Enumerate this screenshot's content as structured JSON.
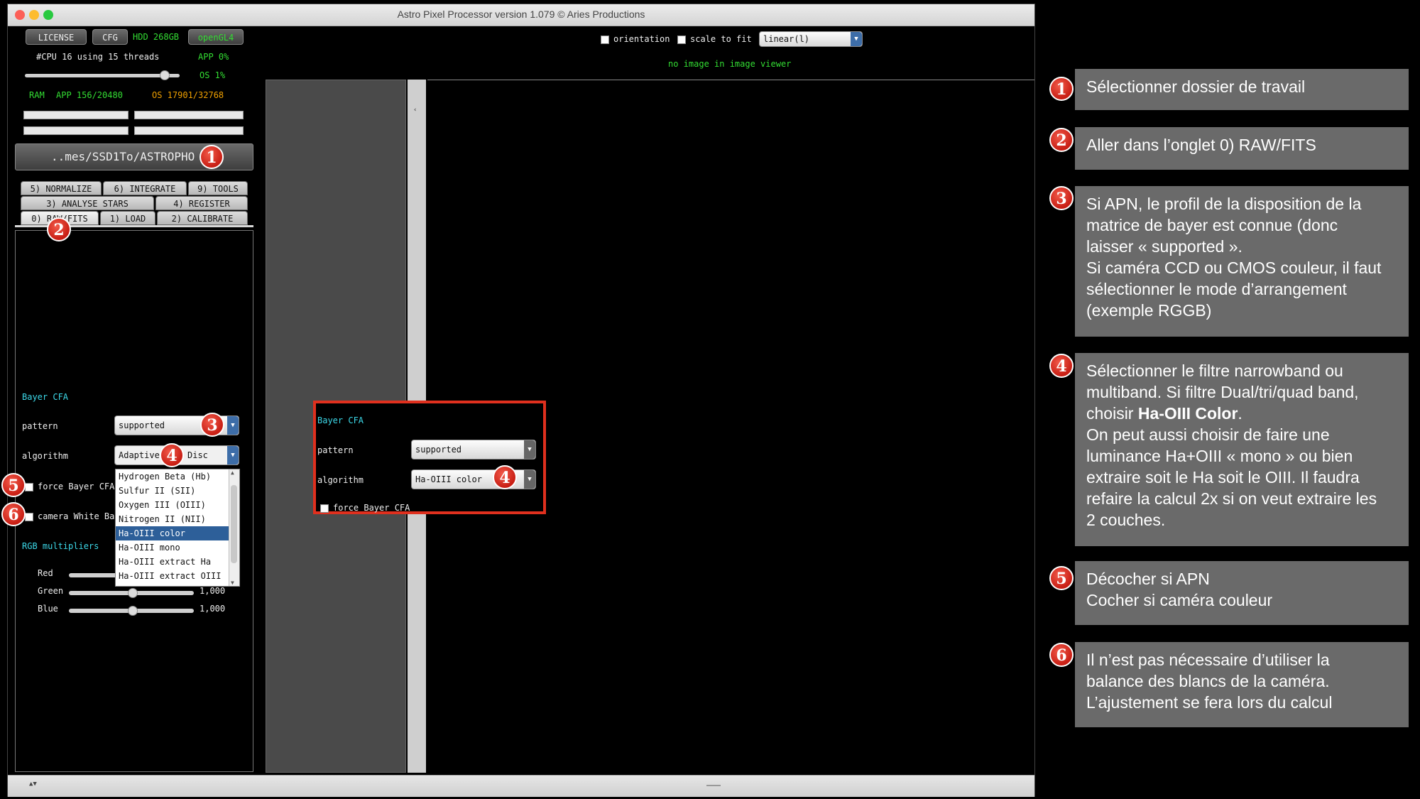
{
  "window": {
    "title": "Astro Pixel Processor version 1.079 © Aries Productions"
  },
  "top_buttons": {
    "license": "LICENSE",
    "cfg": "CFG",
    "hdd": "HDD 268GB",
    "opengl": "openGL4"
  },
  "system": {
    "cpu": "#CPU 16  using 15 threads",
    "app": "APP 0%",
    "os": "OS 1%",
    "ram_label": "RAM",
    "ram_app": "APP 156/20480",
    "ram_os": "OS 17901/32768"
  },
  "folder_button": "..mes/SSD1To/ASTROPHO",
  "tabs": {
    "row1": [
      "5) NORMALIZE",
      "6) INTEGRATE",
      "9) TOOLS"
    ],
    "row2": [
      "3) ANALYSE STARS",
      "4) REGISTER"
    ],
    "row3": [
      "0) RAW/FITS",
      "1) LOAD",
      "2) CALIBRATE"
    ]
  },
  "left_panel": {
    "section": "Bayer CFA",
    "pattern_label": "pattern",
    "pattern_value": "supported",
    "algorithm_label": "algorithm",
    "algorithm_value": "Adaptive",
    "algorithm_value_tail": "Disc",
    "force_label": "force Bayer CFA",
    "camera_label": "camera White Ba",
    "rgb_label": "RGB multipliers",
    "red": "Red",
    "green": "Green",
    "blue": "Blue",
    "green_value": "1,000",
    "blue_value": "1,000"
  },
  "dropdown_options": [
    "Hydrogen Beta (Hb)",
    "Sulfur II (SII)",
    "Oxygen III (OIII)",
    "Nitrogen II (NII)",
    "Ha-OIII color",
    "Ha-OIII mono",
    "Ha-OIII extract Ha",
    "Ha-OIII extract OIII"
  ],
  "dropdown_selected": "Ha-OIII color",
  "viewer": {
    "orientation": "orientation",
    "scale": "scale to fit",
    "stretch": "linear(l)",
    "status": "no image in image viewer"
  },
  "zoom_panel": {
    "section": "Bayer CFA",
    "pattern_label": "pattern",
    "pattern_value": "supported",
    "algorithm_label": "algorithm",
    "algorithm_value": "Ha-OIII color",
    "force_label": "force Bayer CFA"
  },
  "badges": [
    "1",
    "2",
    "3",
    "4",
    "5",
    "6"
  ],
  "notes": [
    {
      "num": "1",
      "lines": [
        "Sélectionner dossier de travail"
      ]
    },
    {
      "num": "2",
      "lines": [
        "Aller dans l’onglet 0) RAW/FITS"
      ]
    },
    {
      "num": "3",
      "lines": [
        "Si APN, le profil de la disposition de la",
        "matrice de bayer est connue (donc",
        "laisser « supported ».",
        "Si caméra CCD ou CMOS couleur, il faut",
        "sélectionner le mode d’arrangement",
        "(exemple RGGB)"
      ]
    },
    {
      "num": "4",
      "lines_a": [
        "Sélectionner le filtre narrowband ou",
        "multiband. Si filtre Dual/tri/quad band,"
      ],
      "bold_prefix": "choisir ",
      "bold": "Ha-OIII Color",
      "bold_suffix": ".",
      "lines_b": [
        "On peut aussi choisir de faire une",
        "luminance Ha+OIII « mono » ou bien",
        "extraire soit le Ha soit le OIII. Il faudra",
        "refaire la calcul 2x si on veut extraire les",
        "2 couches."
      ]
    },
    {
      "num": "5",
      "lines": [
        "Décocher si APN",
        "Cocher si caméra couleur"
      ]
    },
    {
      "num": "6",
      "lines": [
        "Il n’est pas nécessaire d’utiliser la",
        "balance des blancs de la caméra.",
        "L’ajustement se fera lors du calcul"
      ]
    }
  ],
  "colors": {
    "badge": "#d6281c",
    "note_bg": "#6a6a6a",
    "accent_green": "#33dd33",
    "accent_orange": "#f0a000",
    "accent_cyan": "#3cd8e8",
    "highlight_red": "#e0301e"
  }
}
